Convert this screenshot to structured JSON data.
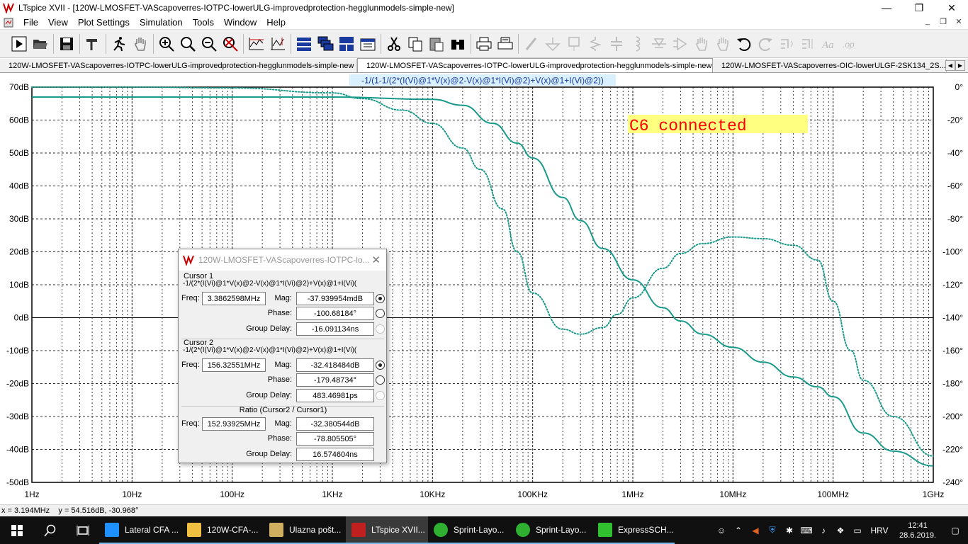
{
  "window": {
    "title": "LTspice XVII - [120W-LMOSFET-VAScapoverres-IOTPC-lowerULG-improvedprotection-hegglunmodels-simple-new]",
    "minimize": "—",
    "restore": "❐",
    "close": "✕"
  },
  "menu": {
    "items": [
      "File",
      "View",
      "Plot Settings",
      "Simulation",
      "Tools",
      "Window",
      "Help"
    ],
    "mdi": [
      "_",
      "❐",
      "✕"
    ]
  },
  "tabs": [
    {
      "label": "120W-LMOSFET-VAScapoverres-IOTPC-lowerULG-improvedprotection-hegglunmodels-simple-new",
      "icon": "schematic-icon"
    },
    {
      "label": "120W-LMOSFET-VAScapoverres-IOTPC-lowerULG-improvedprotection-hegglunmodels-simple-new",
      "icon": "waveform-icon"
    },
    {
      "label": "120W-LMOSFET-VAScapoverres-OIC-lowerULGF-2SK134_2S...",
      "icon": "waveform-icon"
    }
  ],
  "plot": {
    "trace_label": "-1/(1-1/(2*(I(Vi)@1*V(x)@2-V(x)@1*I(Vi)@2)+V(x)@1+I(Vi)@2))",
    "annotation": "C6 connected",
    "colors": {
      "trace": "#1a9a8a",
      "annotation_bg": "#ffff80",
      "annotation_text": "#ff0000",
      "grid": "#000000",
      "label_bg": "#d8f0ff"
    }
  },
  "chart_data": {
    "type": "line",
    "title": "",
    "xlabel": "",
    "ylabel": "",
    "x_scale": "log",
    "x_ticks": [
      "1Hz",
      "10Hz",
      "100Hz",
      "1KHz",
      "10KHz",
      "100KHz",
      "1MHz",
      "10MHz",
      "100MHz",
      "1GHz"
    ],
    "y_ticks_left": [
      "70dB",
      "60dB",
      "50dB",
      "40dB",
      "30dB",
      "20dB",
      "10dB",
      "0dB",
      "-10dB",
      "-20dB",
      "-30dB",
      "-40dB",
      "-50dB"
    ],
    "y_ticks_right": [
      "0°",
      "-20°",
      "-40°",
      "-60°",
      "-80°",
      "-100°",
      "-120°",
      "-140°",
      "-160°",
      "-180°",
      "-200°",
      "-220°",
      "-240°"
    ],
    "xlim_hz": [
      1,
      1000000000
    ],
    "ylim_db": [
      -50,
      70
    ],
    "ylim_phase_deg": [
      -240,
      0
    ],
    "grid": true,
    "series": [
      {
        "style": "solid",
        "axis": "magnitude",
        "x": [
          1,
          10,
          100,
          1000,
          10000,
          20000,
          40000,
          70000,
          100000,
          200000,
          300000,
          500000,
          1000000,
          2000000,
          3000000,
          5000000,
          10000000,
          20000000,
          40000000,
          70000000,
          100000000,
          200000000,
          400000000,
          1000000000
        ],
        "y": [
          67,
          67,
          67,
          67,
          66.3,
          64.5,
          59,
          53,
          48.5,
          36.5,
          29.5,
          21,
          11.5,
          3,
          -1,
          -5,
          -9,
          -13.5,
          -18,
          -21,
          -24,
          -35,
          -40.5,
          -45
        ]
      },
      {
        "style": "dotted",
        "axis": "phase",
        "x": [
          1,
          10,
          100,
          1000,
          2000,
          5000,
          10000,
          20000,
          30000,
          50000,
          70000,
          100000,
          200000,
          300000,
          500000,
          700000,
          1000000,
          2000000,
          3000000,
          5000000,
          10000000,
          20000000,
          40000000,
          70000000,
          100000000,
          150000000,
          200000000,
          400000000,
          1000000000
        ],
        "y": [
          0,
          0,
          -0.5,
          -3.5,
          -7,
          -14,
          -22,
          -37,
          -50,
          -74,
          -100,
          -125,
          -147,
          -150,
          -146,
          -138,
          -128,
          -110,
          -101,
          -95,
          -91,
          -92,
          -96,
          -105,
          -130,
          -160,
          -178,
          -200,
          -224
        ]
      }
    ]
  },
  "dialog": {
    "title": "120W-LMOSFET-VAScapoverres-IOTPC-lo...",
    "close": "✕",
    "cursor1": {
      "header": "Cursor 1",
      "expr": "-1/(2*(I(Vi)@1*V(x)@2-V(x)@1*I(Vi)@2)+V(x)@1+I(Vi)(",
      "freq_label": "Freq:",
      "freq": "3.3862598MHz",
      "mag_label": "Mag:",
      "mag": "-37.939954mdB",
      "phase_label": "Phase:",
      "phase": "-100.68184°",
      "gd_label": "Group Delay:",
      "gd": "-16.091134ns"
    },
    "cursor2": {
      "header": "Cursor 2",
      "expr": "-1/(2*(I(Vi)@1*V(x)@2-V(x)@1*I(Vi)@2)+V(x)@1+I(Vi)(",
      "freq_label": "Freq:",
      "freq": "156.32551MHz",
      "mag_label": "Mag:",
      "mag": "-32.418484dB",
      "phase_label": "Phase:",
      "phase": "-179.48734°",
      "gd_label": "Group Delay:",
      "gd": "483.46981ps"
    },
    "ratio": {
      "header": "Ratio (Cursor2 / Cursor1)",
      "freq_label": "Freq:",
      "freq": "152.93925MHz",
      "mag_label": "Mag:",
      "mag": "-32.380544dB",
      "phase_label": "Phase:",
      "phase": "-78.805505°",
      "gd_label": "Group Delay:",
      "gd": "16.574604ns"
    }
  },
  "status": {
    "text": "x = 3.194MHz    y = 54.516dB, -30.968°"
  },
  "taskbar": {
    "apps": [
      {
        "label": "Lateral CFA ...",
        "icon": "edge-icon",
        "active": false
      },
      {
        "label": "120W-CFA-...",
        "icon": "folder-icon",
        "active": false
      },
      {
        "label": "Ulazna pošt...",
        "icon": "mail-icon",
        "active": false
      },
      {
        "label": "LTspice XVII...",
        "icon": "ltspice-icon",
        "active": true
      },
      {
        "label": "Sprint-Layo...",
        "icon": "sprint-icon",
        "active": false
      },
      {
        "label": "Sprint-Layo...",
        "icon": "sprint-icon",
        "active": false
      },
      {
        "label": "ExpressSCH...",
        "icon": "express-icon",
        "active": false
      }
    ],
    "lang": "HRV",
    "time": "12:41",
    "date": "28.6.2019."
  }
}
